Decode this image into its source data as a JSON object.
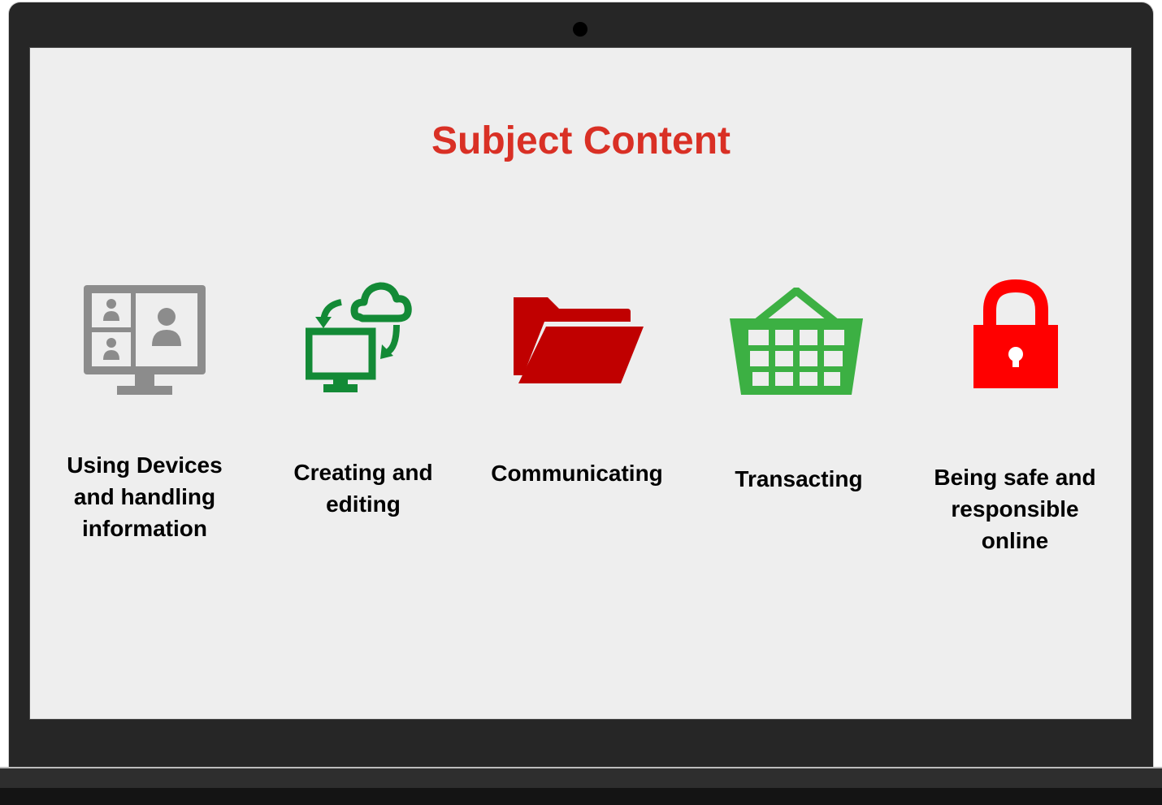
{
  "title": "Subject Content",
  "colors": {
    "title": "#d93025",
    "devices_icon": "#8c8c8c",
    "creating_icon": "#138a36",
    "folder_icon": "#c00000",
    "basket_icon": "#3cb043",
    "lock_icon": "#ff0000"
  },
  "topics": [
    {
      "label": "Using Devices\nand handling\ninformation",
      "icon": "video-conference-monitor-icon"
    },
    {
      "label": "Creating and\nediting",
      "icon": "cloud-sync-icon"
    },
    {
      "label": "Communicating",
      "icon": "folder-icon"
    },
    {
      "label": "Transacting",
      "icon": "shopping-basket-icon"
    },
    {
      "label": "Being safe and\nresponsible\nonline",
      "icon": "padlock-icon"
    }
  ]
}
